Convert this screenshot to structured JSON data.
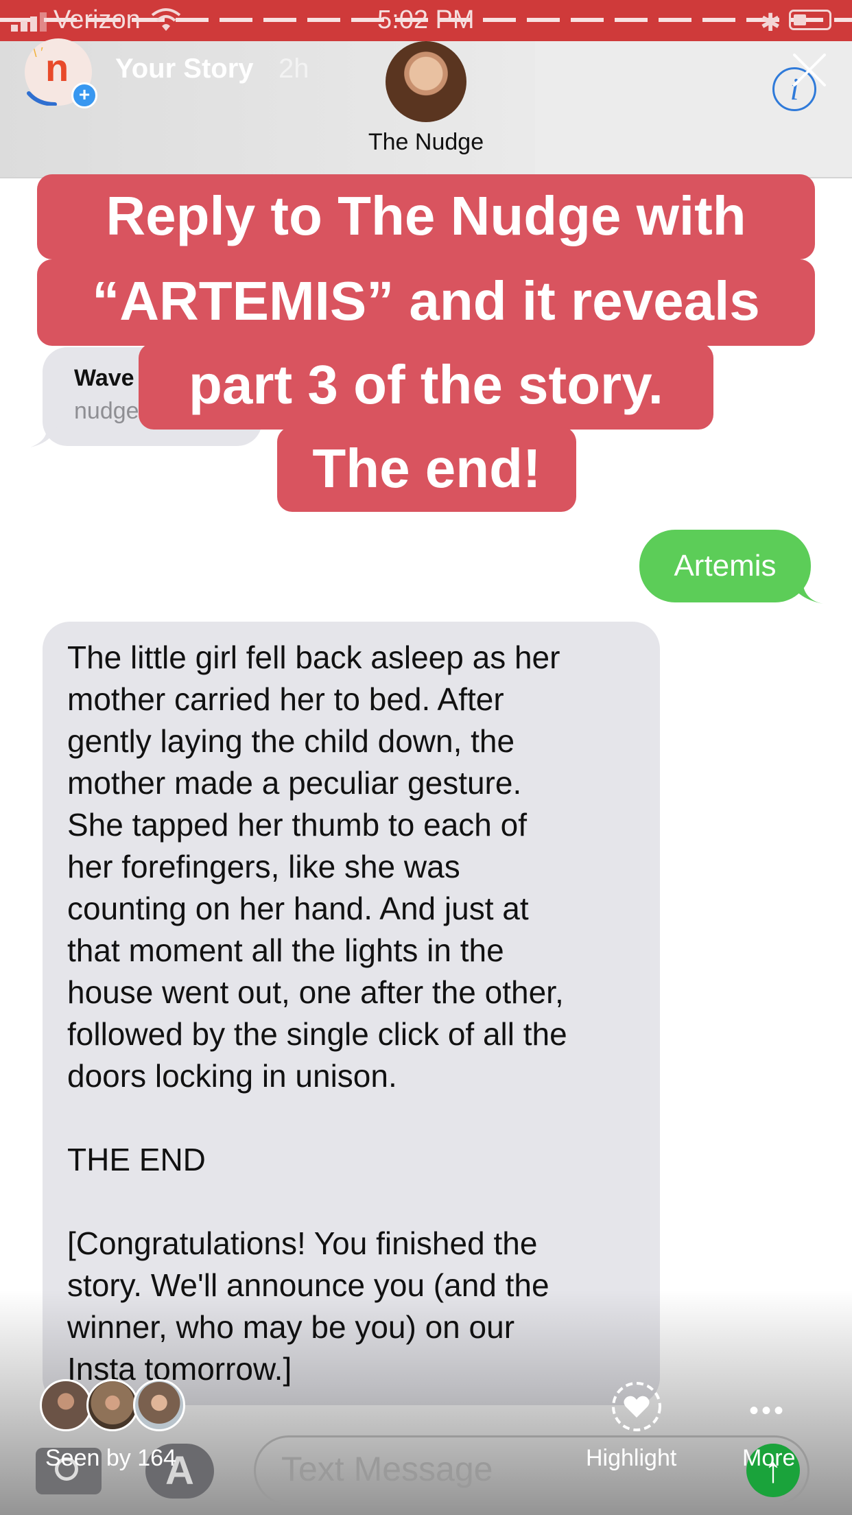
{
  "status_bar": {
    "carrier": "Verizon",
    "time": "5:02 PM"
  },
  "story_header": {
    "title": "Your Story",
    "time_ago": "2h"
  },
  "conversation": {
    "contact_name": "The Nudge",
    "faded_message": {
      "title": "Wave",
      "subtitle": "nudge"
    },
    "sent_message": "Artemis",
    "received_message": "The little girl fell back asleep as her\nmother carried her to bed. After\ngently laying the child down, the\nmother made a peculiar gesture.\nShe tapped her thumb to each of\nher forefingers, like she was\ncounting on her hand. And just at\nthat moment all the lights in the\nhouse went out, one after the other,\nfollowed by the single click of all the\ndoors locking in unison.\n\nTHE END\n\n[Congratulations! You finished the\nstory. We'll announce you (and the\nwinner, who may be you) on our\nInsta tomorrow.]",
    "input_placeholder": "Text Message"
  },
  "overlay_caption": {
    "line1": "Reply to The Nudge with",
    "line2": "“ARTEMIS” and it reveals",
    "line3": "part 3 of the story.",
    "line4": "The end!"
  },
  "story_footer": {
    "seen_by": "Seen by 164",
    "highlight_label": "Highlight",
    "more_label": "More"
  },
  "colors": {
    "status_bar": "#cf3a3a",
    "caption_bg": "#d9545f",
    "sent_bubble": "#5ccd58",
    "received_bubble": "#e5e5ea",
    "info_blue": "#2f7ad9"
  }
}
